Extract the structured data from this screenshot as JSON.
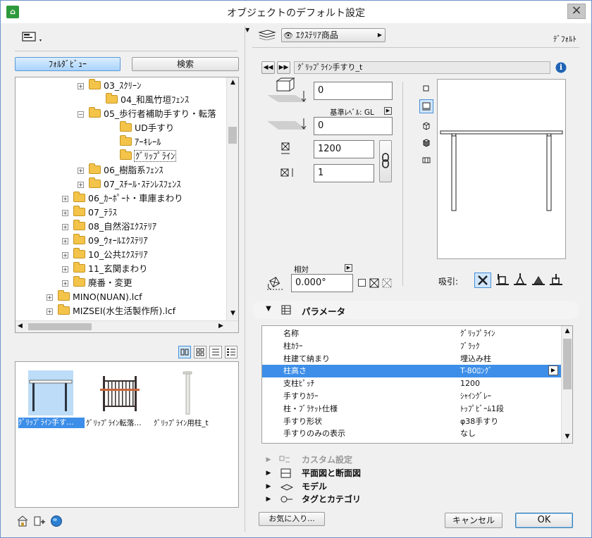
{
  "window": {
    "title": "オブジェクトのデフォルト設定",
    "close_label": "×"
  },
  "left": {
    "folder_view_tab": "ﾌｫﾙﾀﾞﾋﾞｭｰ",
    "search_tab": "検索",
    "tree": [
      {
        "label": "03_ｽｸﾘｰﾝ",
        "expander": "+"
      },
      {
        "label": "04_和風竹垣ﾌｪﾝｽ",
        "expander": ""
      },
      {
        "label": "05_歩行者補助手すり・転落",
        "expander": "−"
      },
      {
        "label": "UD手すり",
        "expander": ""
      },
      {
        "label": "ｱｰｷﾚｰﾙ",
        "expander": ""
      },
      {
        "label": "ｸﾞﾘｯﾌﾟﾗｲﾝ",
        "expander": ""
      },
      {
        "label": "06_樹脂系ﾌｪﾝｽ",
        "expander": "+"
      },
      {
        "label": "07_ｽﾁｰﾙ･ｽﾃﾝﾚｽﾌｪﾝｽ",
        "expander": "+"
      },
      {
        "label": "06_ｶｰﾎﾟｰﾄ・車庫まわり",
        "expander": "+"
      },
      {
        "label": "07_ﾃﾗｽ",
        "expander": "+"
      },
      {
        "label": "08_自然浴ｴｸｽﾃﾘｱ",
        "expander": "+"
      },
      {
        "label": "09_ｳｫｰﾙｴｸｽﾃﾘｱ",
        "expander": "+"
      },
      {
        "label": "10_公共ｴｸｽﾃﾘｱ",
        "expander": "+"
      },
      {
        "label": "11_玄関まわり",
        "expander": "+"
      },
      {
        "label": "廃番・変更",
        "expander": "+"
      },
      {
        "label": "MINO(NUAN).lcf",
        "expander": "+"
      },
      {
        "label": "MIZSEI(水生活製作所).lcf",
        "expander": "+"
      }
    ],
    "thumbnails": [
      {
        "label": "ｸﾞﾘｯﾌﾟﾗｲﾝ手す…"
      },
      {
        "label": "ｸﾞﾘｯﾌﾟﾗｲﾝ転落…"
      },
      {
        "label": "ｸﾞﾘｯﾌﾟﾗｲﾝ用柱_t"
      }
    ]
  },
  "right": {
    "layer_name": "ｴｸｽﾃﾘｱ商品",
    "default_label": "ﾃﾞﾌｫﾙﾄ",
    "object_name": "ｸﾞﾘｯﾌﾟﾗｲﾝ手すり_t",
    "info_icon": "i",
    "offset_top": "0",
    "ref_level_label": "基準ﾚﾍﾞﾙ: GL",
    "offset_bottom": "0",
    "width": "1200",
    "depth": "1",
    "angle_label": "相対",
    "angle": "0.000°",
    "snap_label": "吸引:"
  },
  "params": {
    "section_label": "パラメータ",
    "rows": [
      {
        "name": "名称",
        "value": "ｸﾞﾘｯﾌﾟﾗｲﾝ"
      },
      {
        "name": "柱ｶﾗｰ",
        "value": "ﾌﾞﾗｯｸ"
      },
      {
        "name": "柱建て納まり",
        "value": "埋込み柱"
      },
      {
        "name": "柱高さ",
        "value": "T-80ﾛﾝｸﾞ"
      },
      {
        "name": "支柱ﾋﾟｯﾁ",
        "value": "1200"
      },
      {
        "name": "手すりｶﾗｰ",
        "value": "ｼｬｲﾝｸﾞﾚｰ"
      },
      {
        "name": "柱・ﾌﾞﾗｹｯﾄ仕様",
        "value": "ﾄｯﾌﾟﾋﾞｰﾑ1段"
      },
      {
        "name": "手すり形状",
        "value": "φ38手すり"
      },
      {
        "name": "手すりのみの表示",
        "value": "なし"
      }
    ]
  },
  "sections": {
    "custom": "カスタム設定",
    "plan": "平面図と断面図",
    "model": "モデル",
    "tags": "タグとカテゴリ"
  },
  "footer": {
    "favorites": "お気に入り...",
    "cancel": "キャンセル",
    "ok": "OK"
  }
}
